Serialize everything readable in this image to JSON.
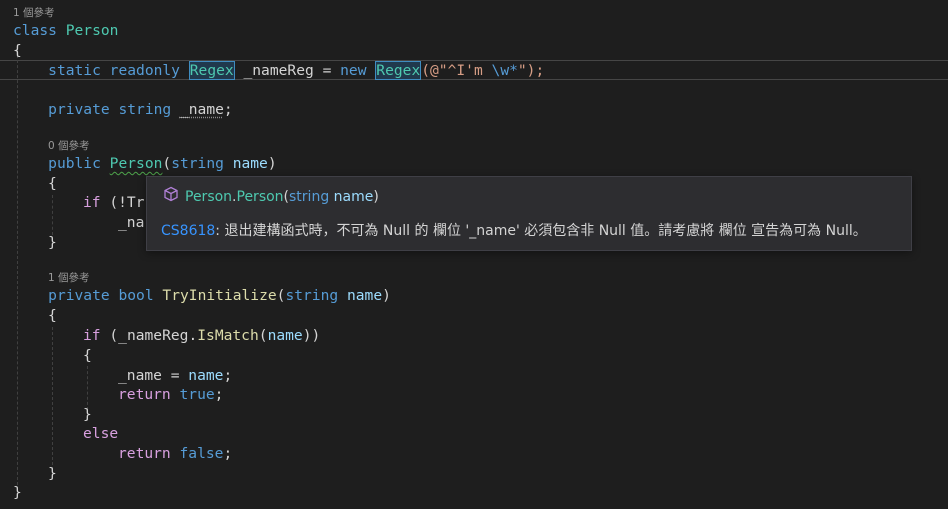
{
  "code_lens": {
    "class_refs": "1 個參考",
    "ctor_refs": "0 個參考",
    "method_refs": "1 個參考"
  },
  "code": {
    "class_kw": "class",
    "class_name": "Person",
    "open_brace": "{",
    "close_brace": "}",
    "static_kw": "static",
    "readonly_kw": "readonly",
    "regex_type": "Regex",
    "field_namereg": " _nameReg = ",
    "new_kw": "new",
    "regex_ctor": "Regex",
    "str_prefix": "(@\"^I'm ",
    "str_escape": "\\w*",
    "str_suffix": "\");",
    "private_kw": "private",
    "string_kw": "string",
    "field_name": "_name",
    "semicolon": ";",
    "public_kw": "public",
    "ctor_name": "Person",
    "paren_open": "(",
    "paren_close": ")",
    "param_name": "name",
    "if_kw": "if",
    "if_partial": " (!Tr",
    "name_partial": "_na",
    "bool_kw": "bool",
    "method_name": "TryInitialize",
    "namereg_ref": "(_nameReg.",
    "ismatch": "IsMatch",
    "if_close": "))",
    "assign": "_name = ",
    "return_kw": "return",
    "true_kw": "true",
    "false_kw": "false",
    "else_kw": "else"
  },
  "tooltip": {
    "sig_class": "Person",
    "sig_dot": ".",
    "sig_ctor": "Person",
    "sig_open": "(",
    "sig_type": "string",
    "sig_param": " name",
    "sig_close": ")",
    "error_code": "CS8618",
    "error_message": ": 退出建構函式時，不可為 Null 的 欄位 '_name' 必須包含非 Null 值。請考慮將 欄位 宣告為可為 Null。"
  },
  "colors": {
    "background": "#1e1e1e",
    "keyword": "#569cd6",
    "type": "#4ec9b0",
    "method": "#dcdcaa",
    "parameter": "#9cdcfe",
    "string": "#d69d85",
    "control": "#d8a0df",
    "link": "#3794ff"
  }
}
